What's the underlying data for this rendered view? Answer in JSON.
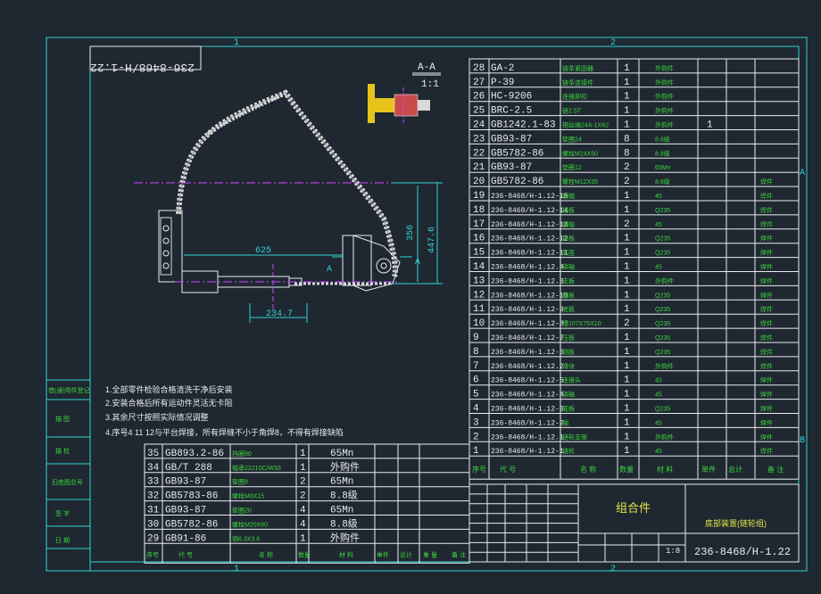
{
  "border": {
    "zone_1": "1",
    "zone_2": "2",
    "zone_a": "A",
    "zone_b": "B"
  },
  "drawing_no_rotated": "236-8468/H-1.22",
  "section": {
    "label": "A-A",
    "scale": "1:1"
  },
  "dimensions": {
    "d625": "625",
    "d356": "356",
    "d447": "447.6",
    "d234": "234.7",
    "mark_a": "A"
  },
  "notes": {
    "n1": "1.全部零件检验合格清洗干净后安装",
    "n2": "2.安装合格后所有运动件灵活无卡阻",
    "n3": "3.其余尺寸按照实际情况调整",
    "n4": "4.序号4  11  12与平台焊接，所有焊缝不小于角焊8，不得有焊接缺陷"
  },
  "left_labels": [
    "借(通)用件登记",
    "描  图",
    "描  校",
    "旧底图总号",
    "签  字",
    "日  期"
  ],
  "parts_upper": [
    {
      "no": "28",
      "code": "GA-2",
      "name": "链条紧固器",
      "qty": "1",
      "mat": "外购件",
      "w": "",
      "note": ""
    },
    {
      "no": "27",
      "code": "P-39",
      "name": "链条连接件",
      "qty": "1",
      "mat": "外购件",
      "w": "",
      "note": ""
    },
    {
      "no": "26",
      "code": "HC-9206",
      "name": "连接卸扣",
      "qty": "1",
      "mat": "外购件",
      "w": "",
      "note": ""
    },
    {
      "no": "25",
      "code": "BRC-2.5",
      "name": "链2.5T",
      "qty": "1",
      "mat": "外购件",
      "w": "",
      "note": ""
    },
    {
      "no": "24",
      "code": "GB1242.1-83",
      "name": "钢丝绳24A-1X62",
      "qty": "1",
      "mat": "外购件",
      "w": "1",
      "note": ""
    },
    {
      "no": "23",
      "code": "GB93-87",
      "name": "垫圈24",
      "qty": "8",
      "mat": "8.8级",
      "w": "",
      "note": ""
    },
    {
      "no": "22",
      "code": "GB5782-86",
      "name": "螺栓M24X50",
      "qty": "8",
      "mat": "8.8级",
      "w": "",
      "note": ""
    },
    {
      "no": "21",
      "code": "GB93-87",
      "name": "垫圈12",
      "qty": "2",
      "mat": "65Mn",
      "w": "",
      "note": ""
    },
    {
      "no": "20",
      "code": "GB5782-86",
      "name": "螺栓M12X35",
      "qty": "2",
      "mat": "8.8级",
      "w": "",
      "note": "焊件"
    },
    {
      "no": "19",
      "code": "236-8468/H-1.12-15",
      "name": "销轴",
      "qty": "1",
      "mat": "45",
      "w": "",
      "note": "焊件"
    },
    {
      "no": "18",
      "code": "236-8468/H-1.12-14",
      "name": "挡板",
      "qty": "1",
      "mat": "Q235",
      "w": "",
      "note": "焊件"
    },
    {
      "no": "17",
      "code": "236-8468/H-1.12-13",
      "name": "销轴",
      "qty": "2",
      "mat": "45",
      "w": "",
      "note": "焊件"
    },
    {
      "no": "16",
      "code": "236-8468/H-1.12-12",
      "name": "拉板",
      "qty": "1",
      "mat": "Q235",
      "w": "",
      "note": "焊件"
    },
    {
      "no": "15",
      "code": "236-8468/H-1.12-11",
      "name": "底座",
      "qty": "1",
      "mat": "Q235",
      "w": "",
      "note": "焊件"
    },
    {
      "no": "14",
      "code": "236-8468/H-1.12.4",
      "name": "销轴",
      "qty": "1",
      "mat": "45",
      "w": "",
      "note": "焊件"
    },
    {
      "no": "13",
      "code": "236-8468/H-1.12.3",
      "name": "支板",
      "qty": "1",
      "mat": "外购件",
      "w": "",
      "note": "焊件"
    },
    {
      "no": "12",
      "code": "236-8468/H-1.12-10",
      "name": "筋板",
      "qty": "1",
      "mat": "Q235",
      "w": "",
      "note": "焊件"
    },
    {
      "no": "11",
      "code": "236-8468/H-1.12-9",
      "name": "底板",
      "qty": "1",
      "mat": "Q235",
      "w": "",
      "note": "焊件"
    },
    {
      "no": "10",
      "code": "236-8468/H-1.12-8",
      "name": "槽107X75X10",
      "qty": "2",
      "mat": "Q235",
      "w": "",
      "note": "焊件"
    },
    {
      "no": "9",
      "code": "236-8468/H-1.12-7",
      "name": "压板",
      "qty": "1",
      "mat": "Q235",
      "w": "",
      "note": "焊件"
    },
    {
      "no": "8",
      "code": "236-8468/H-1.12-6",
      "name": "侧板",
      "qty": "1",
      "mat": "Q235",
      "w": "",
      "note": "焊件"
    },
    {
      "no": "7",
      "code": "236-8468/H-1.12.2",
      "name": "滑块",
      "qty": "1",
      "mat": "外购件",
      "w": "",
      "note": "焊件"
    },
    {
      "no": "6",
      "code": "236-8468/H-1.12-5",
      "name": "连接头",
      "qty": "1",
      "mat": "45",
      "w": "",
      "note": "焊件"
    },
    {
      "no": "5",
      "code": "236-8468/H-1.12-4",
      "name": "销轴",
      "qty": "1",
      "mat": "45",
      "w": "",
      "note": "焊件"
    },
    {
      "no": "4",
      "code": "236-8468/H-1.12-3",
      "name": "底板",
      "qty": "1",
      "mat": "Q235",
      "w": "",
      "note": "焊件"
    },
    {
      "no": "3",
      "code": "236-8468/H-1.12-2",
      "name": "轴",
      "qty": "1",
      "mat": "45",
      "w": "",
      "note": "焊件"
    },
    {
      "no": "2",
      "code": "236-8468/H-1.12.1",
      "name": "链轮支架",
      "qty": "1",
      "mat": "外购件",
      "w": "",
      "note": "焊件"
    },
    {
      "no": "1",
      "code": "236-8468/H-1.12-1",
      "name": "链轮",
      "qty": "1",
      "mat": "45",
      "w": "",
      "note": "焊件"
    }
  ],
  "parts_lower": [
    {
      "no": "35",
      "code": "GB893.2-86",
      "name": "挡圈90",
      "qty": "1",
      "mat": "65Mn"
    },
    {
      "no": "34",
      "code": "GB/T 288",
      "name": "轴承22210C/W33",
      "qty": "1",
      "mat": "外购件"
    },
    {
      "no": "33",
      "code": "GB93-87",
      "name": "垫圈8",
      "qty": "2",
      "mat": "65Mn"
    },
    {
      "no": "32",
      "code": "GB5783-86",
      "name": "螺栓M8X15",
      "qty": "2",
      "mat": "8.8级"
    },
    {
      "no": "31",
      "code": "GB93-87",
      "name": "垫圈20",
      "qty": "4",
      "mat": "65Mn"
    },
    {
      "no": "30",
      "code": "GB5782-86",
      "name": "螺栓M20X60",
      "qty": "4",
      "mat": "8.8级"
    },
    {
      "no": "29",
      "code": "GB91-86",
      "name": "销6.3X3.6",
      "qty": "1",
      "mat": "外购件"
    }
  ],
  "table_headers": {
    "no": "序号",
    "code": "代  号",
    "name": "名  称",
    "qty": "数量",
    "mat": "材  料",
    "unit": "单件",
    "total": "总计",
    "weight": "重  量",
    "note": "备  注"
  },
  "title_block": {
    "assembly": "组合件",
    "project": "底部装置(链轮组)",
    "scale": "1:8",
    "drawing_no": "236-8468/H-1.22"
  }
}
